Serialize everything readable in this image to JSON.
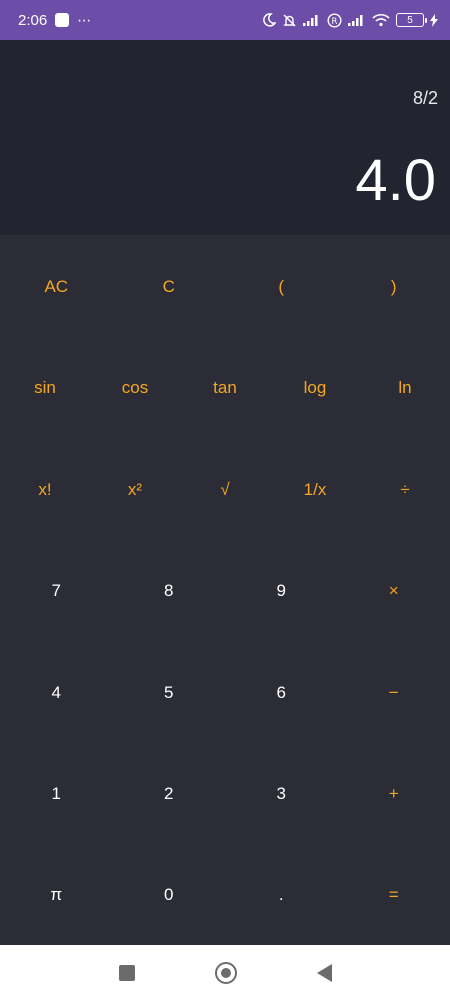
{
  "status_bar": {
    "time": "2:06",
    "dots": "⋯",
    "battery_level": "5",
    "icons": [
      "moon-icon",
      "bell-off-icon",
      "signal-icon",
      "roaming-icon",
      "signal-icon",
      "wifi-icon",
      "battery-icon",
      "charging-icon"
    ]
  },
  "display": {
    "expression": "8/2",
    "result": "4.0"
  },
  "keypad": {
    "row1": [
      "AC",
      "C",
      "(",
      ")"
    ],
    "row2": [
      "sin",
      "cos",
      "tan",
      "log",
      "ln"
    ],
    "row3": [
      "x!",
      "x²",
      "√",
      "1/x",
      "÷"
    ],
    "row4": [
      "7",
      "8",
      "9",
      "×"
    ],
    "row5": [
      "4",
      "5",
      "6",
      "−"
    ],
    "row6": [
      "1",
      "2",
      "3",
      "+"
    ],
    "row7": [
      "π",
      "0",
      ".",
      "="
    ]
  },
  "colors": {
    "status_bar": "#6c4ea8",
    "display_bg": "#222430",
    "keypad_bg": "#2b2c35",
    "accent_orange": "#f5a623",
    "digit_white": "#ffffff"
  },
  "nav_bar": {
    "icons": [
      "recents-icon",
      "home-icon",
      "back-icon"
    ]
  }
}
